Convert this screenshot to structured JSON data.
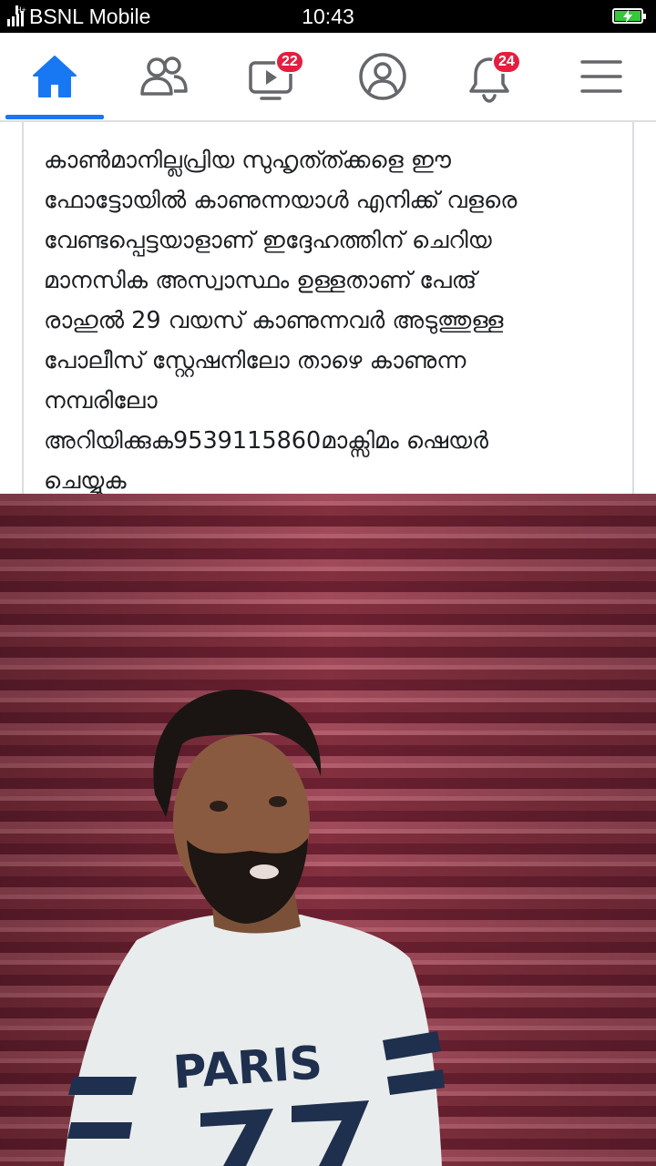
{
  "status_bar": {
    "network_type": "H+",
    "carrier": "BSNL Mobile",
    "time": "10:43",
    "battery_status": "charging"
  },
  "nav": {
    "items": [
      {
        "name": "home",
        "icon": "home-icon",
        "active": true
      },
      {
        "name": "friends",
        "icon": "friends-icon"
      },
      {
        "name": "watch",
        "icon": "video-icon",
        "badge": "22"
      },
      {
        "name": "profile",
        "icon": "profile-icon"
      },
      {
        "name": "notifications",
        "icon": "bell-icon",
        "badge": "24"
      },
      {
        "name": "menu",
        "icon": "hamburger-menu-icon"
      }
    ],
    "accent_color": "#1877f2",
    "badge_color": "#e41e3f"
  },
  "post": {
    "lines": [
      "കാൺമാനില്ലപ്രിയ സുഹൃത്ത്ക്കളെ ഈ",
      "ഫോട്ടോയിൽ കാണുന്നയാൾ എനിക്ക് വളരെ",
      "വേണ്ടപ്പെട്ടയാളാണ് ഇദ്ദേഹത്തിന് ചെറിയ",
      "മാനസിക അസ്വാസ്ഥം ഉള്ളതാണ് പേരു്",
      "രാഹുൽ 29 വയസ് കാണുന്നവർ അടുത്തുള്ള",
      "പോലീസ് സ്റ്റേഷനിലോ താഴെ കാണുന്ന",
      "നമ്പരിലോ",
      "അറിയിക്കുക9539115860മാക്സിമം ഷെയർ",
      "ചെയ്യുക"
    ]
  },
  "photo": {
    "shirt_text": "PARIS"
  }
}
